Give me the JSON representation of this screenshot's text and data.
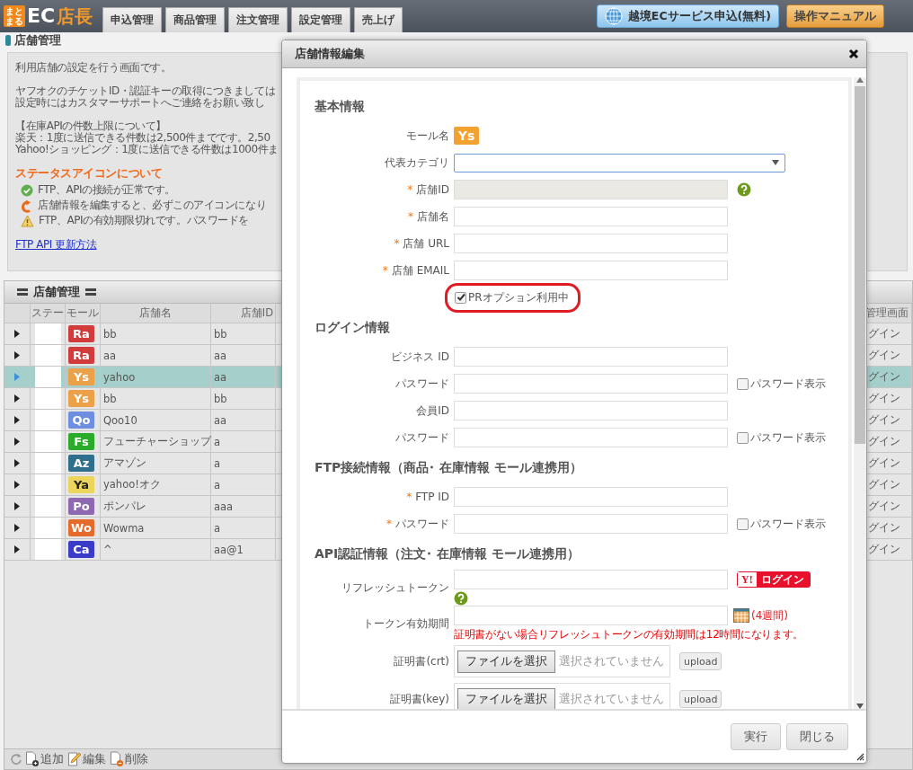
{
  "header": {
    "logo": {
      "mark": [
        "まと",
        "まる"
      ],
      "brand": "EC",
      "brand_suffix": "店長"
    },
    "nav": [
      {
        "label": "申込管理"
      },
      {
        "label": "商品管理"
      },
      {
        "label": "注文管理"
      },
      {
        "label": "設定管理"
      },
      {
        "label": "売上げ"
      }
    ],
    "actions": [
      {
        "kind": "globe",
        "label": "越境ECサービス申込(無料)"
      },
      {
        "kind": "manual",
        "label": "操作マニュアル"
      }
    ]
  },
  "page_title": "店舗管理",
  "info": {
    "intro": "利用店舗の設定を行う画面です。",
    "notes": [
      "ヤフオクのチケットID・認証キーの取得につきましては",
      "設定時にはカスタマーサポートへご連絡をお願い致し"
    ],
    "limits_title": "【在庫APIの件数上限について】",
    "limits": [
      "楽天：1度に送信できる件数は2,500件までです。2,50",
      "Yahoo!ショッピング：1度に送信できる件数は1000件ま"
    ],
    "status_heading": "ステータスアイコンについて",
    "status_items": [
      {
        "kind": "ok",
        "text": "FTP、APIの接続が正常です。"
      },
      {
        "kind": "edited",
        "text": "店舗情報を編集すると、必ずこのアイコンになり"
      },
      {
        "kind": "warning",
        "text": "FTP、APIの有効期限切れです。パスワードを"
      }
    ],
    "link": "FTP API 更新方法"
  },
  "grid": {
    "title": "店舗管理",
    "columns": [
      "ステー",
      "モール",
      "店舗名",
      "店舗ID"
    ],
    "right_column": "管理画面",
    "rows": [
      {
        "mall": {
          "code": "Ra",
          "color": "#d13b3b"
        },
        "name": "bb",
        "id": "bb",
        "login": "グイン",
        "selected": false
      },
      {
        "mall": {
          "code": "Ra",
          "color": "#d13b3b"
        },
        "name": "aa",
        "id": "aa",
        "login": "グイン",
        "selected": false
      },
      {
        "mall": {
          "code": "Ys",
          "color": "#eca048"
        },
        "name": "yahoo",
        "id": "aa",
        "login": "グイン",
        "selected": true
      },
      {
        "mall": {
          "code": "Ys",
          "color": "#eca048"
        },
        "name": "bb",
        "id": "bb",
        "login": "グイン",
        "selected": false
      },
      {
        "mall": {
          "code": "Qo",
          "color": "#6e8fe0"
        },
        "name": "Qoo10",
        "id": "aa",
        "login": "グイン",
        "selected": false
      },
      {
        "mall": {
          "code": "Fs",
          "color": "#2aab2a"
        },
        "name": "フューチャーショップ",
        "id": "a",
        "login": "グイン",
        "selected": false
      },
      {
        "mall": {
          "code": "Az",
          "color": "#2f6f8d"
        },
        "name": "アマゾン",
        "id": "a",
        "login": "グイン",
        "selected": false
      },
      {
        "mall": {
          "code": "Ya",
          "color": "#edd45c"
        },
        "name": "yahoo!オク",
        "id": "a",
        "login": "グイン",
        "selected": false
      },
      {
        "mall": {
          "code": "Po",
          "color": "#8e68b0"
        },
        "name": "ポンパレ",
        "id": "aaa",
        "login": "グイン",
        "selected": false
      },
      {
        "mall": {
          "code": "Wo",
          "color": "#e46b2a"
        },
        "name": "Wowma",
        "id": "a",
        "login": "グイン",
        "selected": false
      },
      {
        "mall": {
          "code": "Ca",
          "color": "#3b3bc9"
        },
        "name": "^",
        "id": "aa@1",
        "login": "グイン",
        "selected": false
      }
    ],
    "toolbar": [
      {
        "kind": "add",
        "label": "追加"
      },
      {
        "kind": "edit",
        "label": "編集"
      },
      {
        "kind": "delete",
        "label": "削除"
      }
    ]
  },
  "dialog": {
    "title": "店舗情報編集",
    "sections": [
      {
        "heading": "基本情報",
        "fields": [
          {
            "kind": "badge",
            "label": "モール名",
            "value": "Ys",
            "color": "#f3a230"
          },
          {
            "kind": "select",
            "label": "代表カテゴリ"
          },
          {
            "kind": "text",
            "label": "店舗ID",
            "mark": "*",
            "disabled": true,
            "help": true
          },
          {
            "kind": "text",
            "label": "店舗名",
            "mark": "*",
            "disabled": false
          },
          {
            "kind": "text",
            "label": "店舗 URL",
            "mark": "*",
            "disabled": false
          },
          {
            "kind": "text",
            "label": "店舗 EMAIL",
            "mark": "*",
            "disabled": false
          },
          {
            "kind": "checkbox",
            "label": "PRオプション利用中",
            "checked": true,
            "highlighted": true
          }
        ]
      },
      {
        "heading": "ログイン情報",
        "fields": [
          {
            "kind": "text",
            "label": "ビジネス ID",
            "disabled": false
          },
          {
            "kind": "text",
            "label": "パスワード",
            "disabled": false,
            "show_password": {
              "label": "パスワード表示",
              "checked": false
            }
          },
          {
            "kind": "text",
            "label": "会員ID",
            "disabled": false
          },
          {
            "kind": "text",
            "label": "パスワード",
            "disabled": false,
            "show_password": {
              "label": "パスワード表示",
              "checked": false
            }
          }
        ]
      },
      {
        "heading": "FTP接続情報（商品･ 在庫情報 モール連携用）",
        "fields": [
          {
            "kind": "text",
            "label": "FTP ID",
            "mark": "*",
            "disabled": false
          },
          {
            "kind": "text",
            "label": "パスワード",
            "mark": "*",
            "disabled": false,
            "show_password": {
              "label": "パスワード表示",
              "checked": false
            }
          }
        ]
      },
      {
        "heading": "API認証情報（注文･ 在庫情報 モール連携用）",
        "fields": [
          {
            "kind": "token",
            "label": "リフレッシュトークン",
            "login": {
              "logo": "Y!",
              "label": "ログイン"
            },
            "help": true
          },
          {
            "kind": "date",
            "label": "トークン有効期間",
            "suffix": "(4週間)",
            "note": "証明書がない場合リフレッシュトークンの有効期間は12時間になります。"
          },
          {
            "kind": "file",
            "label": "証明書(crt)",
            "button": "ファイルを選択",
            "status": "選択されていません",
            "upload": "upload"
          },
          {
            "kind": "file",
            "label": "証明書(key)",
            "button": "ファイルを選択",
            "status": "選択されていません",
            "upload": "upload"
          }
        ]
      }
    ],
    "buttons": [
      "実行",
      "閉じる"
    ]
  }
}
